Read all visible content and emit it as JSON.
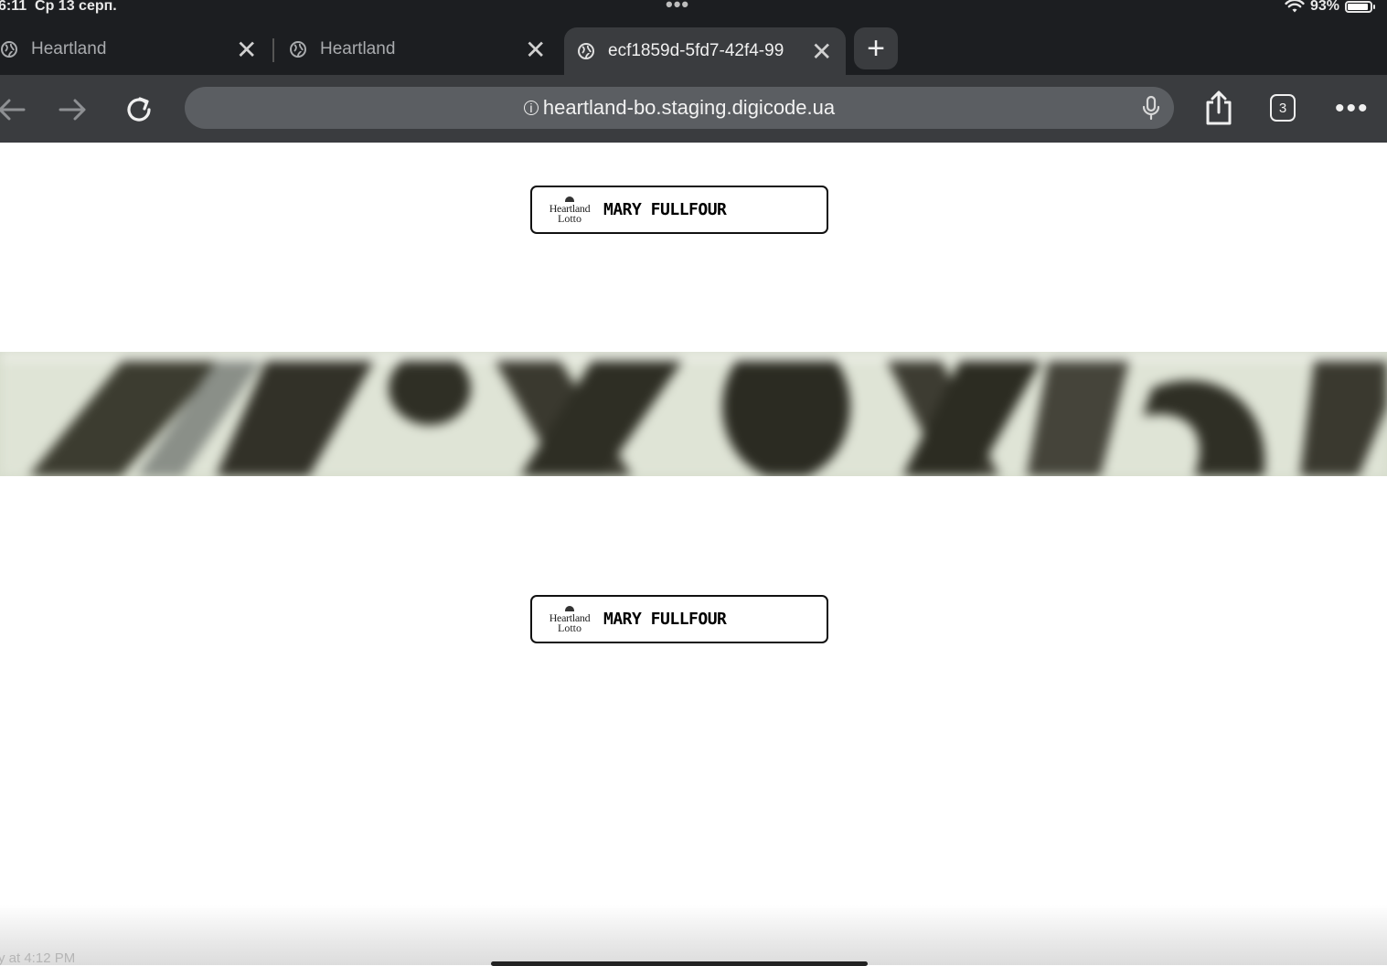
{
  "status_bar": {
    "time": "6:11",
    "date": "Ср 13 серп.",
    "battery_percent": "93%",
    "battery_level": 0.93
  },
  "tabs": [
    {
      "title": "Heartland",
      "active": false
    },
    {
      "title": "Heartland",
      "active": false
    },
    {
      "title": "ecf1859d-5fd7-42f4-99",
      "active": true
    }
  ],
  "toolbar": {
    "url": "heartland-bo.staging.digicode.ua",
    "tab_count": "3"
  },
  "badges": [
    {
      "logo_line1": "Heartland",
      "logo_line2": "Lotto",
      "name": "MARY FULLFOUR"
    },
    {
      "logo_line1": "Heartland",
      "logo_line2": "Lotto",
      "name": "MARY FULLFOUR"
    }
  ],
  "footer": {
    "caption": "y at 4:12 PM"
  },
  "colors": {
    "chrome_dark": "#1c1e21",
    "toolbar": "#3a3c3f",
    "address_bar": "#5b5e62"
  }
}
